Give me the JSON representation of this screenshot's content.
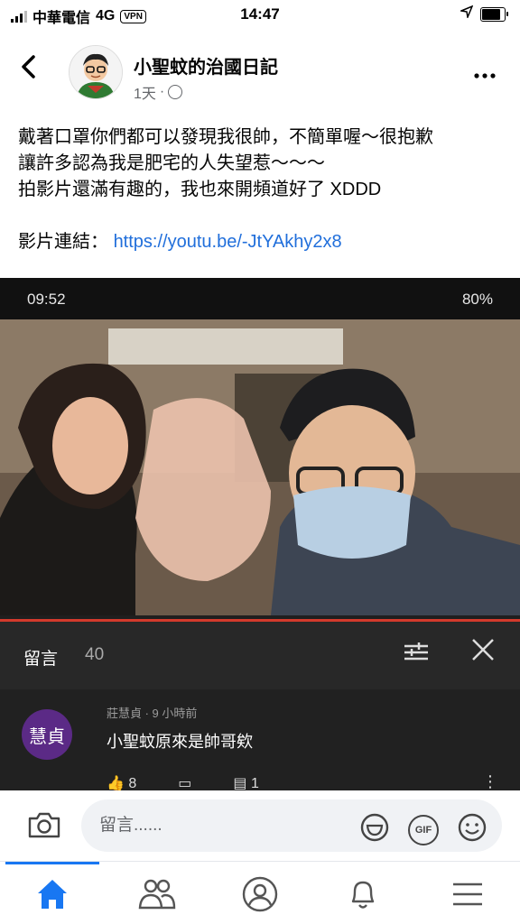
{
  "status_bar": {
    "carrier": "中華電信",
    "network": "4G",
    "vpn": "VPN",
    "time": "14:47"
  },
  "post": {
    "page_name": "小聖蚊的治國日記",
    "meta_time": "1天",
    "meta_sep": "·",
    "body_lines": [
      "戴著口罩你們都可以發現我很帥，不簡單喔～很抱歉",
      "讓許多認為我是肥宅的人失望惹～～～",
      "拍影片還滿有趣的，我也來開頻道好了 XDDD"
    ],
    "link_label": "影片連結：",
    "link_url": "https://youtu.be/-JtYAkhy2x8"
  },
  "video_screenshot": {
    "status_time": "09:52",
    "battery": "80%",
    "comments_title": "留言",
    "comments_count": "40",
    "comment": {
      "avatar_text": "慧貞",
      "author": "莊慧貞 · 9 小時前",
      "text": "小聖蚊原來是帥哥欸",
      "likes": "8",
      "replies": "1"
    }
  },
  "composer": {
    "placeholder": "留言......"
  },
  "colors": {
    "link": "#216fdb",
    "accent": "#1877f2",
    "youtube_red": "#d33a2c",
    "comment_avatar": "#5b2a86"
  }
}
